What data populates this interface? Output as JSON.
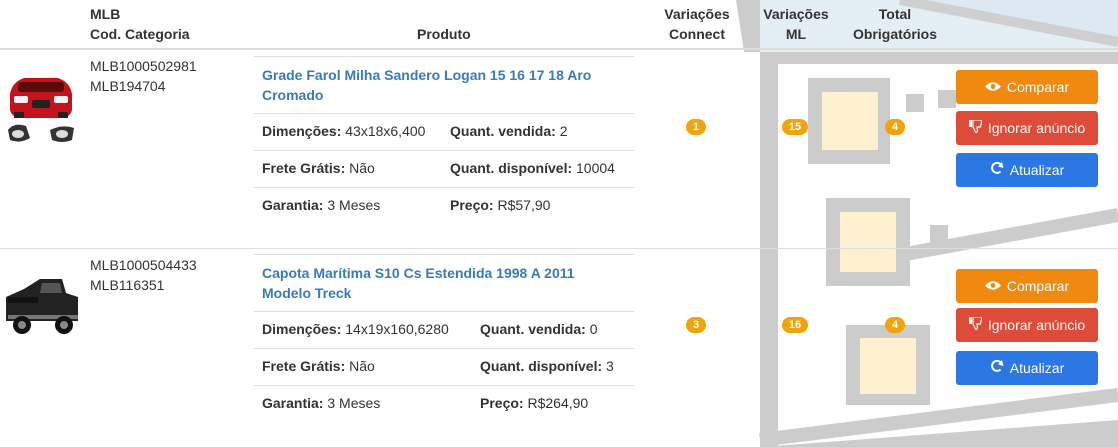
{
  "header": {
    "col_mlb_line1": "MLB",
    "col_mlb_line2": "Cod. Categoria",
    "col_produto": "Produto",
    "col_var_connect_line1": "Variações",
    "col_var_connect_line2": "Connect",
    "col_var_ml_line1": "Variações",
    "col_var_ml_line2": "ML",
    "col_total_line1": "Total",
    "col_total_line2": "Obrigatórios"
  },
  "rows": [
    {
      "image_icon": "car-red-headlight-grill-image",
      "mlb": "MLB1000502981",
      "categoria": "MLB194704",
      "title": "Grade Farol Milha Sandero Logan 15 16 17 18 Aro Cromado",
      "dim_label": "Dimenções:",
      "dim_value": "43x18x6,400",
      "sold_label": "Quant. vendida:",
      "sold_value": "2",
      "frete_label": "Frete Grátis:",
      "frete_value": "Não",
      "disp_label": "Quant. disponível:",
      "disp_value": "10004",
      "garantia_label": "Garantia:",
      "garantia_value": "3 Meses",
      "preco_label": "Preço:",
      "preco_value": "R$57,90",
      "var_connect": "1",
      "var_ml": "15",
      "total_obrig": "4",
      "btn_compare": "Comparar",
      "btn_ignore": "Ignorar anúncio",
      "btn_update": "Atualizar"
    },
    {
      "image_icon": "black-pickup-truck-image",
      "mlb": "MLB1000504433",
      "categoria": "MLB116351",
      "title": "Capota Marítima S10 Cs Estendida 1998 A 2011 Modelo Treck",
      "dim_label": "Dimenções:",
      "dim_value": "14x19x160,6280",
      "sold_label": "Quant. vendida:",
      "sold_value": "0",
      "frete_label": "Frete Grátis:",
      "frete_value": "Não",
      "disp_label": "Quant. disponível:",
      "disp_value": "3",
      "garantia_label": "Garantia:",
      "garantia_value": "3 Meses",
      "preco_label": "Preço:",
      "preco_value": "R$264,90",
      "var_connect": "3",
      "var_ml": "16",
      "total_obrig": "4",
      "btn_compare": "Comparar",
      "btn_ignore": "Ignorar anúncio",
      "btn_update": "Atualizar"
    }
  ],
  "icons": {
    "compare": "eye-icon",
    "ignore": "thumbs-down-icon",
    "update": "refresh-icon"
  },
  "colors": {
    "badge": "#f0a30a",
    "compare": "#f0890f",
    "ignore": "#dd4b39",
    "update": "#2b78e4",
    "title_link": "#3a7ab8"
  }
}
